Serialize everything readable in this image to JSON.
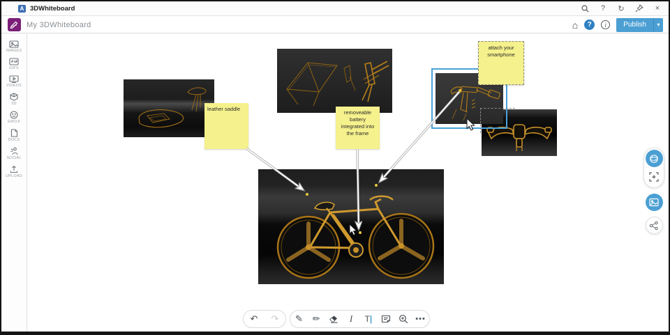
{
  "window": {
    "title": "3DWhiteboard",
    "app_badge": "A"
  },
  "titlebar": {
    "icons": {
      "help": "?",
      "refresh": "↻",
      "close": "×"
    }
  },
  "menubar": {
    "board_title": "My 3DWhiteboard",
    "home_icon": "⌂",
    "help_icon": "?",
    "info_icon": "i",
    "publish_label": "Publish",
    "publish_caret": "▾"
  },
  "sidebar": {
    "items": [
      {
        "label": "IMAGES"
      },
      {
        "label": "GIFS"
      },
      {
        "label": "VIDEOS"
      },
      {
        "label": "3D"
      },
      {
        "label": "EMOJI"
      },
      {
        "label": "DOCS"
      },
      {
        "label": "SOCIAL"
      },
      {
        "label": "UPLOAD"
      }
    ]
  },
  "canvas": {
    "notes": [
      {
        "text": "leather saddle"
      },
      {
        "text": "removeable battery integrated into the frame"
      },
      {
        "text": "attach your smartphone"
      }
    ],
    "images": [
      {
        "name": "saddle-sketch"
      },
      {
        "name": "frame-sketches"
      },
      {
        "name": "smartphone-mount-sketch",
        "selected": true
      },
      {
        "name": "handlebar-front-sketch"
      },
      {
        "name": "bike-render"
      }
    ]
  },
  "bottom_toolbar": {
    "undo": "↶",
    "redo": "↷",
    "pen": "✎",
    "marker": "✏",
    "text_select": "I",
    "text_tool": "T",
    "text_cursor": "|",
    "more": "•••"
  },
  "colors": {
    "accent_blue": "#4b9fd3",
    "selection_blue": "#4aa0d8",
    "sticky_yellow": "#f5f18c",
    "sketch_gold": "#c8922b",
    "logo_purple": "#7b1e78"
  }
}
